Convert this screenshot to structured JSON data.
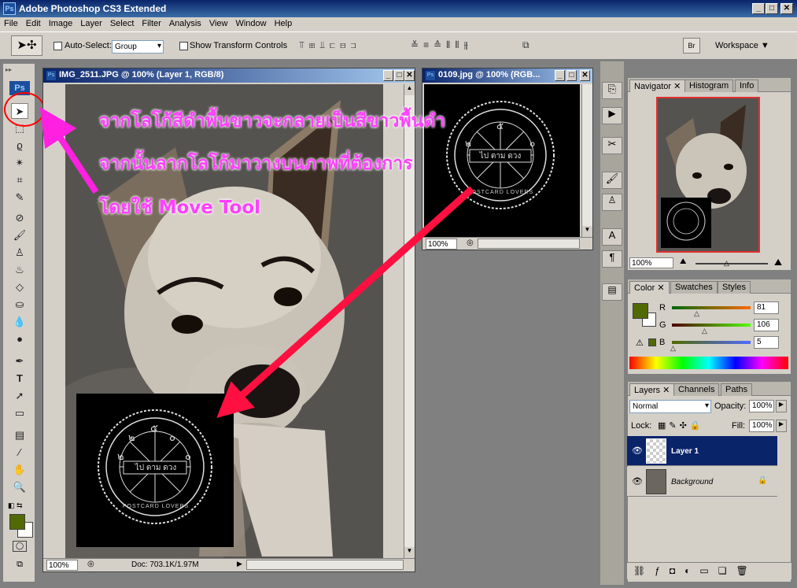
{
  "app": {
    "title": "Adobe Photoshop CS3 Extended",
    "icon": "Ps"
  },
  "menu": [
    "File",
    "Edit",
    "Image",
    "Layer",
    "Select",
    "Filter",
    "Analysis",
    "View",
    "Window",
    "Help"
  ],
  "options": {
    "auto_select_label": "Auto-Select:",
    "auto_select_value": "Group",
    "transform_label": "Show Transform Controls",
    "workspace_label": "Workspace ▼",
    "bridge_label": "Br"
  },
  "doc1": {
    "title": "IMG_2511.JPG @ 100% (Layer 1, RGB/8)",
    "zoom": "100%",
    "status": "Doc: 703.1K/1.97M"
  },
  "doc2": {
    "title": "0109.jpg @ 100% (RGB...",
    "zoom": "100%"
  },
  "annotation": {
    "line1": "จากโลโก้สีดำพื้นขาวจะกลายเป็นสีขาวพื้นดำ",
    "line2": "จากนั้นลากโลโก้มาวางบนภาพที่ต้องการ",
    "line3": "โดยใช้ Move Tool"
  },
  "logo": {
    "top_left": "๒",
    "top": "๕",
    "top_right": "๐",
    "left": "๒",
    "right": "๐",
    "center": "ไป ตาม ดวง",
    "ring": "POSTCARD LOVERS"
  },
  "navigator": {
    "tabs": [
      "Navigator",
      "Histogram",
      "Info"
    ],
    "zoom": "100%"
  },
  "color": {
    "tabs": [
      "Color",
      "Swatches",
      "Styles"
    ],
    "r_label": "R",
    "g_label": "G",
    "b_label": "B",
    "r": 81,
    "g": 106,
    "b": 5,
    "foreground": "#516a05"
  },
  "layers": {
    "tabs": [
      "Layers",
      "Channels",
      "Paths"
    ],
    "blend": "Normal",
    "opacity_label": "Opacity:",
    "opacity": "100%",
    "lock_label": "Lock:",
    "fill_label": "Fill:",
    "fill": "100%",
    "items": [
      {
        "name": "Layer 1",
        "selected": true
      },
      {
        "name": "Background",
        "selected": false
      }
    ]
  },
  "colors": {
    "accent": "#0a246a",
    "annotation": "#ff40ff",
    "arrow": "#ff0040",
    "circle": "#ff0000"
  }
}
